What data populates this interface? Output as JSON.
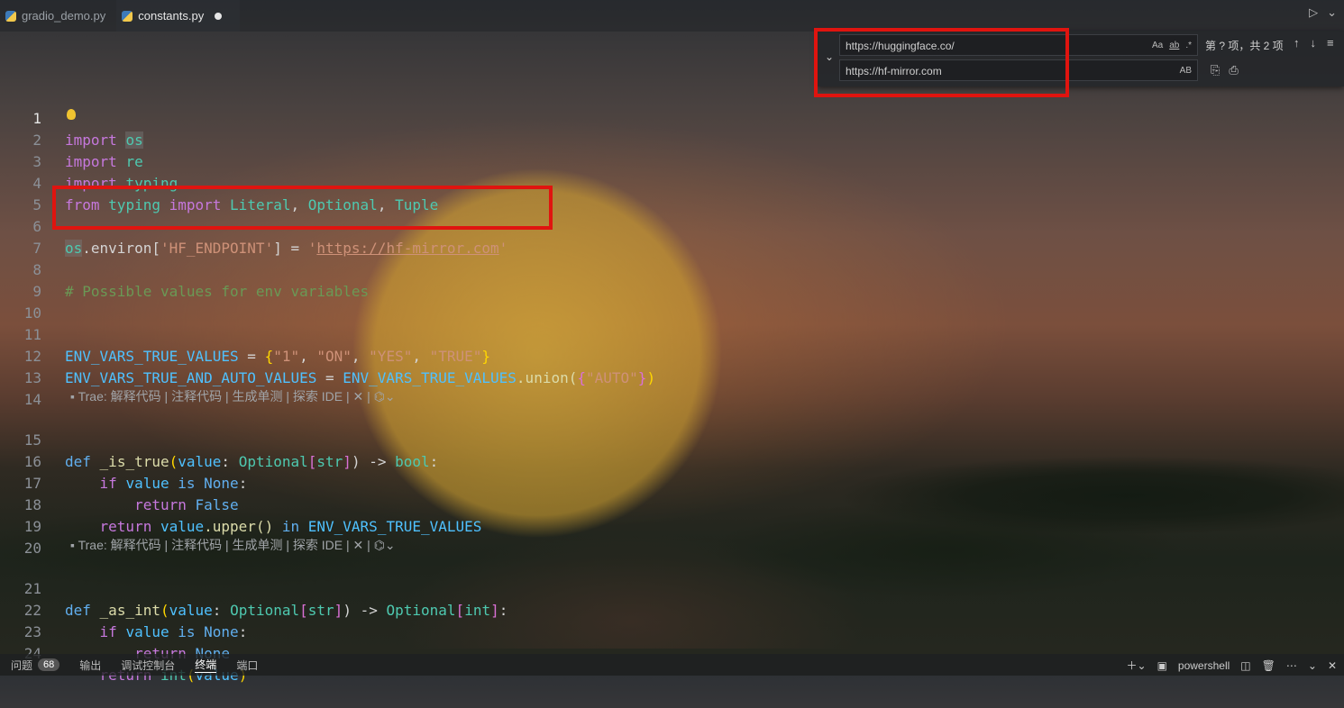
{
  "tabs": [
    {
      "label": "gradio_demo.py",
      "active": false
    },
    {
      "label": "constants.py",
      "active": true,
      "modified": true
    }
  ],
  "find_widget": {
    "find_value": "https://huggingface.co/",
    "replace_value": "https://hf-mirror.com",
    "find_options": [
      "Aa",
      "ab",
      ".*"
    ],
    "replace_option": "AB",
    "status": "第 ? 项，共 2 项",
    "nav": [
      "↑",
      "↓",
      "≡"
    ]
  },
  "codelens": {
    "text": "Trae: 解释代码 | 注释代码 | 生成单测 | 探索 IDE | ✕ |"
  },
  "lines": [
    {
      "n": "1",
      "current": true
    },
    {
      "n": "2"
    },
    {
      "n": "3"
    },
    {
      "n": "4"
    },
    {
      "n": "5"
    },
    {
      "n": "6"
    },
    {
      "n": "7"
    },
    {
      "n": "8"
    },
    {
      "n": "9"
    },
    {
      "n": "10"
    },
    {
      "n": "11"
    },
    {
      "n": "12"
    },
    {
      "n": "13"
    },
    {
      "n": "14"
    },
    {
      "n": "15"
    },
    {
      "n": "16"
    },
    {
      "n": "17"
    },
    {
      "n": "18"
    },
    {
      "n": "19"
    },
    {
      "n": "20"
    },
    {
      "n": "21"
    },
    {
      "n": "22"
    },
    {
      "n": "23"
    },
    {
      "n": "24"
    }
  ],
  "code": {
    "l1": [
      "import",
      "os"
    ],
    "l2": [
      "import",
      "re"
    ],
    "l3": [
      "import",
      "typing"
    ],
    "l4": [
      "from",
      "typing",
      "import",
      "Literal",
      "Optional",
      "Tuple"
    ],
    "l6": [
      "os",
      ".environ[",
      "'HF_ENDPOINT'",
      "] = ",
      "'",
      "https://hf-mirror.com",
      "'"
    ],
    "l8": "# Possible values for env variables",
    "l11": [
      "ENV_VARS_TRUE_VALUES",
      " = ",
      "{",
      "\"1\"",
      "\"ON\"",
      "\"YES\"",
      "\"TRUE\"",
      "}"
    ],
    "l12": [
      "ENV_VARS_TRUE_AND_AUTO_VALUES",
      " = ",
      "ENV_VARS_TRUE_VALUES",
      ".union(",
      "{",
      "\"AUTO\"",
      "}",
      ")"
    ],
    "l15": [
      "def",
      "_is_true",
      "(",
      "value",
      ": ",
      "Optional",
      "[",
      "str",
      "]",
      ") -> ",
      "bool",
      ":"
    ],
    "l16": [
      "if",
      "value",
      "is",
      "None",
      ":"
    ],
    "l17": [
      "return",
      "False"
    ],
    "l18": [
      "return",
      "value",
      ".upper()",
      "in",
      "ENV_VARS_TRUE_VALUES"
    ],
    "l21": [
      "def",
      "_as_int",
      "(",
      "value",
      ": ",
      "Optional",
      "[",
      "str",
      "]",
      ") -> ",
      "Optional",
      "[",
      "int",
      "]",
      ":"
    ],
    "l22": [
      "if",
      "value",
      "is",
      "None",
      ":"
    ],
    "l23": [
      "return",
      "None"
    ],
    "l24": [
      "return",
      "int",
      "(",
      "value",
      ")"
    ]
  },
  "panel": {
    "tabs": [
      "问题",
      "输出",
      "调试控制台",
      "终端",
      "端口"
    ],
    "problems_count": "68",
    "active_tab": "终端",
    "terminal_name": "powershell"
  },
  "colors": {
    "highlight_red": "#e0140f",
    "keyword": "#c678dd",
    "string": "#ce9178"
  }
}
